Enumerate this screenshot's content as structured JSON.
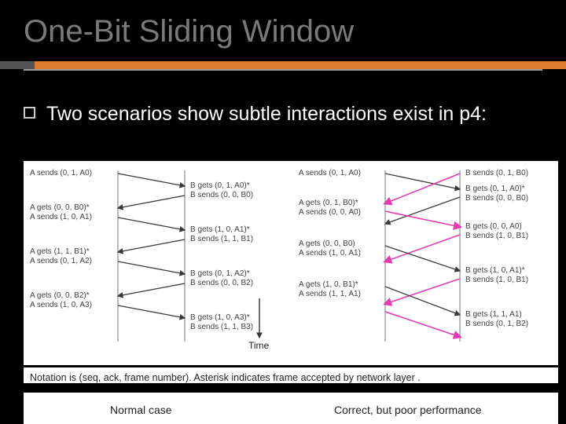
{
  "title": "One-Bit Sliding Window",
  "bullet": "Two scenarios show subtle interactions exist in p4:",
  "notation": "Notation is (seq, ack, frame number). Asterisk indicates frame accepted by network layer .",
  "captions": {
    "left": "Normal case",
    "right": "Correct, but poor performance"
  },
  "time_label": "Time",
  "left": {
    "A_send0": "A sends (0, 1, A0)",
    "B_get0": "B gets (0, 1, A0)*",
    "B_send0": "B sends (0, 0, B0)",
    "A_get0": "A gets (0, 0, B0)*",
    "A_send1": "A sends (1, 0, A1)",
    "B_get1": "B gets (1, 0, A1)*",
    "B_send1": "B sends (1, 1, B1)",
    "A_get1": "A gets (1, 1, B1)*",
    "A_send2": "A sends (0, 1, A2)",
    "B_get2": "B gets (0, 1, A2)*",
    "B_send2": "B sends (0, 0, B2)",
    "A_get2": "A gets (0, 0, B2)*",
    "A_send3": "A sends (1, 0, A3)",
    "B_get3": "B gets (1, 0, A3)*",
    "B_send3": "B sends (1, 1, B3)"
  },
  "right": {
    "A_send0": "A sends (0, 1, A0)",
    "B_send0a": "B sends (0, 1, B0)",
    "B_get0": "B gets (0, 1, A0)*",
    "B_send0b": "B sends (0, 0, B0)",
    "A_get0a": "A gets (0, 1, B0)*",
    "A_send0b": "A sends (0, 0, A0)",
    "B_get0b": "B gets (0, 0, A0)",
    "B_send1a": "B sends (1, 0, B1)",
    "A_get0b": "A gets (0, 0, B0)",
    "A_send1a": "A sends (1, 0, A1)",
    "B_get1a": "B gets (1, 0, A1)*",
    "B_send1b": "B sends (1, 0, B1)",
    "A_get1a": "A gets (1, 0, B1)*",
    "A_send1b": "A sends (1, 1, A1)",
    "B_get1b": "B gets (1, 1, A1)",
    "B_send2": "B sends (0, 1, B2)"
  }
}
